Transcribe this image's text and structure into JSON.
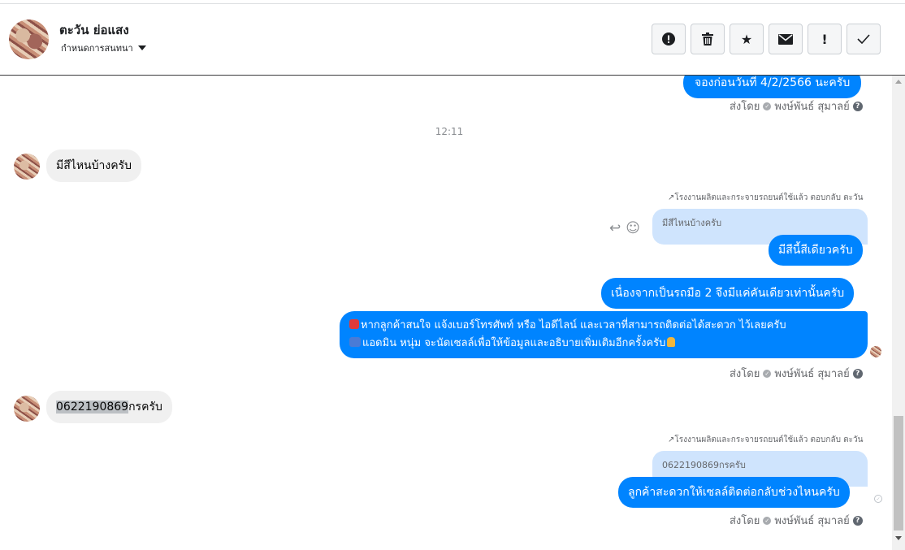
{
  "contact": {
    "name": "ตะวัน ย่อแสง",
    "assign_label": "กำหนดการสนทนา"
  },
  "toolbar": {
    "spam_icon": "!",
    "delete_icon": "🗑",
    "star_icon": "★",
    "unread_icon": "✉",
    "follow_up_icon": "!",
    "done_icon": "✓"
  },
  "thread": {
    "top_partial_text": "จองก่อนวันที่ 4/2/2566 นะครับ",
    "sent_by_prefix": "ส่งโดย",
    "sender_name": "พงษ์พันธ์ สุมาลย์",
    "time": "12:11",
    "incoming_1": "มีสีไหนบ้างครับ",
    "reply_note": "โรงงานผลิตและกระจายรถยนต์ใช้แล้ว ตอบกลับ ตะวัน",
    "quoted_1": "มีสีไหนบ้างครับ",
    "reply_1": "มีสีนี้สีเดียวครับ",
    "outgoing_2": "เนื่องจากเป็นรถมือ 2 จึงมีแค่คันเดียวเท่านั้นครับ",
    "outgoing_3_line1": "หากลูกค้าสนใจ แจ้งเบอร์โทรศัพท์ หรือ ไอดีไลน์ และเวลาที่สามารถติดต่อได้สะดวก ไว้เลยครับ",
    "outgoing_3_line2": "แอดมิน หนุ่ม จะนัดเซลล์เพื่อให้ข้อมูลและอธิบายเพิ่มเติมอีกครั้งครับ",
    "incoming_2_number": "0622190869",
    "incoming_2_rest": "กรครับ",
    "quoted_2": "0622190869กรครับ",
    "reply_2": "ลูกค้าสะดวกให้เซลล์ติดต่อกลับช่วงไหนครับ"
  },
  "colors": {
    "accent": "#0084ff",
    "quoted_bg": "#cfe4fd",
    "incoming_bg": "#f0f0f0"
  }
}
